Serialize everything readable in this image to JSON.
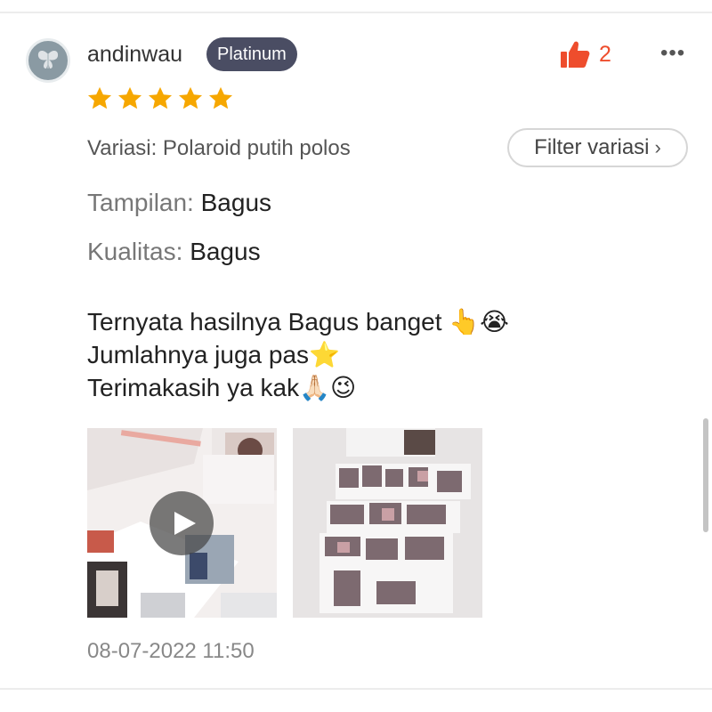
{
  "review": {
    "username": "andinwau",
    "badge": "Platinum",
    "likes": "2",
    "more": "•••",
    "rating": 5,
    "variation": "Variasi: Polaroid putih polos",
    "filter_label": "Filter variasi",
    "filter_chevron": "›",
    "attributes": [
      {
        "key": "Tampilan:",
        "value": "Bagus"
      },
      {
        "key": "Kualitas:",
        "value": "Bagus"
      }
    ],
    "comment_lines": [
      "Ternyata hasilnya Bagus banget 👆😭",
      "Jumlahnya juga pas⭐",
      "Terimakasih ya kak🙏🏻😉"
    ],
    "media": [
      {
        "type": "video",
        "icon": "play-icon"
      },
      {
        "type": "photo"
      }
    ],
    "timestamp": "08-07-2022 11:50"
  },
  "colors": {
    "accent": "#ee4d2d",
    "star": "#f6a700",
    "badge_bg": "#4a4d63"
  }
}
